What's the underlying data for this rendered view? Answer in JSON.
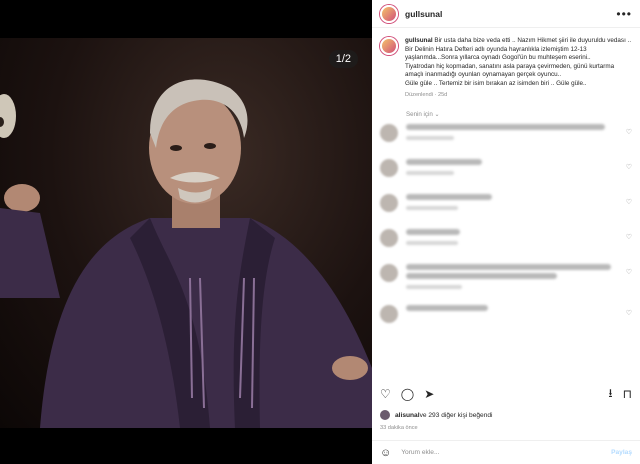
{
  "post": {
    "counter": "1/2",
    "username": "gullsunal",
    "caption_lines": [
      "Bir usta daha bize veda etti .. Nazım Hikmet şiiri ile duyuruldu vedası ..",
      "Bir Delinin Hatıra Defteri adlı oyunda hayranlıkla izlemiştim 12-13 yaşlarımda...Sonra yıllarca oynadı Gogol'ün bu muhteşem eserini..",
      "Tiyatrodan hiç kopmadan, sanatını asla paraya çevirmeden, günü kurtarma amaçlı inanmadığı oyunları oynamayan gerçek oyuncu..",
      "Güle güle .. Tertemiz bir isim bırakan az isimden biri .. Güle güle.."
    ],
    "edited": "Düzenlendi · 25d",
    "for_you": "Senin için ⌄",
    "likes_user": "alisunal",
    "likes_rest": " ve 293 diğer kişi beğendi",
    "time_ago": "33 dakika önce",
    "comment_placeholder": "Yorum ekle...",
    "post_button": "Paylaş"
  },
  "icons": [
    "more-icon",
    "heart-icon",
    "comment-icon",
    "share-icon",
    "save-icon",
    "download-icon",
    "emoji-icon"
  ]
}
